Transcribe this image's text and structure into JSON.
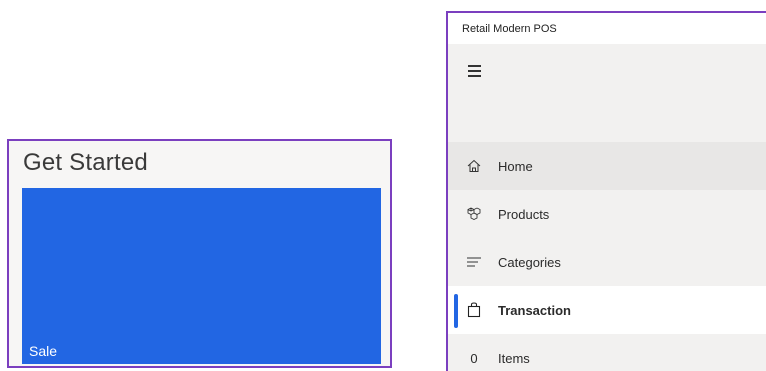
{
  "get_started": {
    "title": "Get Started",
    "tile": {
      "label": "Sale",
      "color": "#2266e3"
    }
  },
  "pos_window": {
    "title": "Retail Modern POS",
    "menu_icon": "hamburger-icon",
    "nav_items": [
      {
        "label": "Home",
        "icon": "home-icon"
      },
      {
        "label": "Products",
        "icon": "boxes-icon"
      },
      {
        "label": "Categories",
        "icon": "lines-icon"
      },
      {
        "label": "Transaction",
        "icon": "shopping-bag-icon",
        "active": true
      },
      {
        "label": "Items",
        "count": "0"
      }
    ]
  },
  "colors": {
    "accent": "#2266e3",
    "frame": "#7b3fbf"
  }
}
